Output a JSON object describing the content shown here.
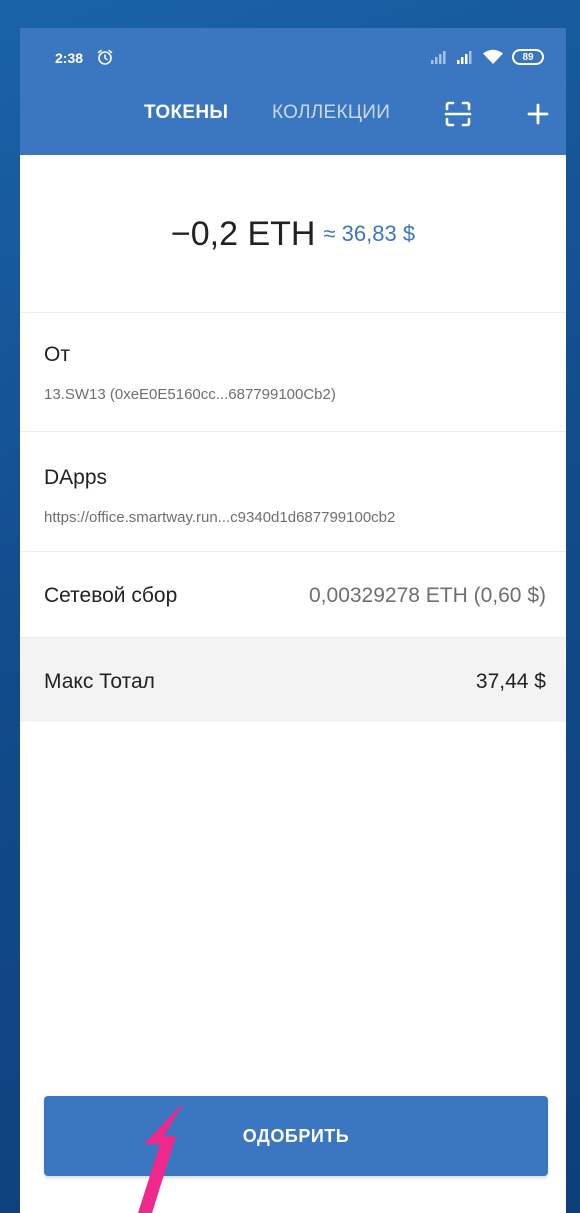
{
  "colors": {
    "accent": "#3b76c0",
    "background_outer": "#124c8c",
    "row_highlight": "#f3f3f3",
    "pointer_arrow": "#f0288c"
  },
  "status_bar": {
    "time": "2:38",
    "alarm_icon": "alarm-clock-icon",
    "battery": "89"
  },
  "app_bar": {
    "tab_tokens": "ТОКЕНЫ",
    "tab_collections": "КОЛЛЕКЦИИ",
    "scan_icon": "scan-icon",
    "add_icon": "plus-icon"
  },
  "amount": {
    "crypto": "−0,2 ETH",
    "fiat": "≈ 36,83 $"
  },
  "details": {
    "from_label": "От",
    "from_value": "13.SW13 (0xeE0E5160cc...687799100Cb2)",
    "dapps_label": "DApps",
    "dapps_value": "https://office.smartway.run...c9340d1d687799100cb2",
    "fee_label": "Сетевой сбор",
    "fee_value": "0,00329278 ETH (0,60 $)",
    "total_label": "Макс Тотал",
    "total_value": "37,44 $"
  },
  "approve_button": "ОДОБРИТЬ"
}
